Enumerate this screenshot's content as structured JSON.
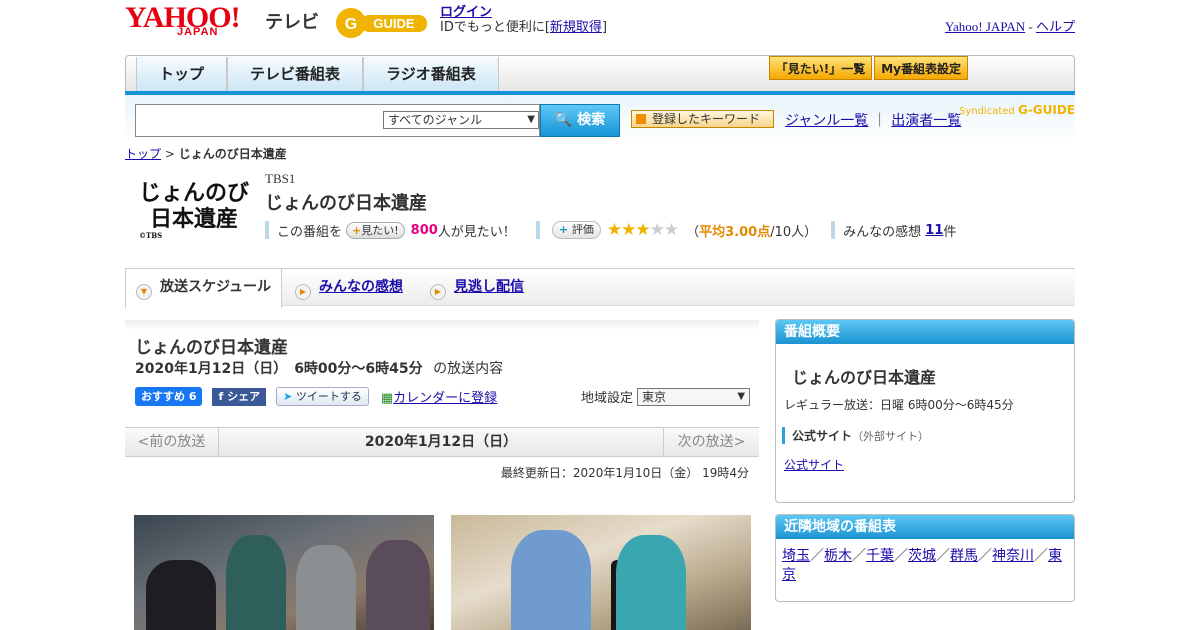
{
  "header": {
    "brand": "YAHOO!",
    "brand_sub": "JAPAN",
    "brand_tv": "テレビ",
    "gguide": "G-GUIDE",
    "login": "ログイン",
    "login_sub_prefix": "IDでもっと便利に[",
    "register": "新規取得",
    "login_sub_suffix": "]",
    "yahoo_japan": "Yahoo! JAPAN",
    "help_sep": " - ",
    "help": "ヘルプ"
  },
  "nav": {
    "tabs": [
      {
        "label": "トップ"
      },
      {
        "label": "テレビ番組表"
      },
      {
        "label": "ラジオ番組表"
      }
    ],
    "mitai_list": "「見たい!」一覧",
    "my_schedule": "My番組表設定"
  },
  "search": {
    "genre_selected": "すべてのジャンル",
    "button": "検索",
    "keyword_button": "登録したキーワード",
    "genre_list": "ジャンル一覧",
    "link_sep": "｜",
    "performer_list": "出演者一覧",
    "syndicated": "Syndicated"
  },
  "breadcrumb": {
    "top": "トップ",
    "sep": " > ",
    "current": "じょんのび日本遺産"
  },
  "program": {
    "logo_text": "じょんのび 日本遺産",
    "logo_copy": "©TBS",
    "channel": "TBS1",
    "title": "じょんのび日本遺産",
    "mitai_prefix": "この番組を",
    "mitai_button": "見たい!",
    "mitai_count": "800",
    "mitai_suffix": "人が見たい！",
    "rating_button": "評価",
    "rating_stars": 3,
    "rating_open": "（",
    "rating_avg": "平均3.00点",
    "rating_people": "/10人）",
    "reviews_prefix": "みんなの感想",
    "reviews_count": "11",
    "reviews_suffix": "件"
  },
  "subtabs": [
    {
      "label": "放送スケジュール",
      "active": true
    },
    {
      "label": "みんなの感想",
      "active": false
    },
    {
      "label": "見逃し配信",
      "active": false
    }
  ],
  "main": {
    "title": "じょんのび日本遺産",
    "date_time": "2020年1月12日（日）　6時00分～6時45分",
    "date_suffix": "の放送内容",
    "fb_recommend": "おすすめ 6",
    "fb_share": "シェア",
    "tweet": "ツイートする",
    "calendar": "カレンダーに登録",
    "region_label": "地域設定",
    "region_selected": "東京",
    "prev": "<前の放送",
    "current_date": "2020年1月12日（日）",
    "next": "次の放送>",
    "updated": "最終更新日：2020年1月10日（金） 19時4分"
  },
  "sidebar": {
    "overview_title": "番組概要",
    "program_title": "じょんのび日本遺産",
    "regular": "レギュラー放送：日曜 6時00分～6時45分",
    "official_heading": "公式サイト",
    "official_note": "（外部サイト）",
    "official_link": "公式サイト",
    "nearby_title": "近隣地域の番組表",
    "areas": [
      "埼玉",
      "栃木",
      "千葉",
      "茨城",
      "群馬",
      "神奈川",
      "東京"
    ],
    "area_sep": "／"
  },
  "colors": {
    "accent_blue": "#1694d8",
    "yahoo_red": "#e60012",
    "pink": "#e4007f",
    "star": "#f0b400"
  }
}
